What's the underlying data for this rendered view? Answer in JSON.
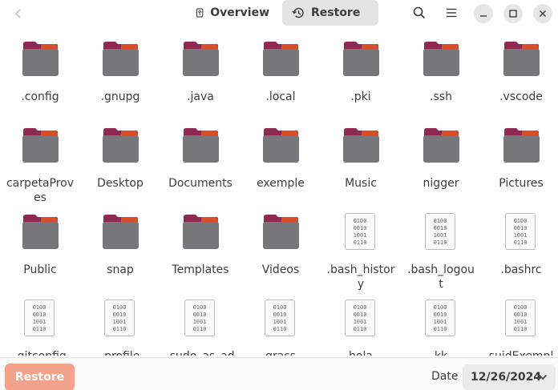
{
  "header": {
    "tabs": [
      {
        "label": "Overview",
        "icon": "device-icon"
      },
      {
        "label": "Restore",
        "icon": "history-icon",
        "active": true
      }
    ]
  },
  "files": [
    {
      "name": ".config",
      "type": "folder"
    },
    {
      "name": ".gnupg",
      "type": "folder"
    },
    {
      "name": ".java",
      "type": "folder"
    },
    {
      "name": ".local",
      "type": "folder"
    },
    {
      "name": ".pki",
      "type": "folder"
    },
    {
      "name": ".ssh",
      "type": "folder"
    },
    {
      "name": ".vscode",
      "type": "folder"
    },
    {
      "name": "carpetaProves",
      "type": "folder"
    },
    {
      "name": "Desktop",
      "type": "folder"
    },
    {
      "name": "Documents",
      "type": "folder"
    },
    {
      "name": "exemple",
      "type": "folder"
    },
    {
      "name": "Music",
      "type": "folder"
    },
    {
      "name": "nigger",
      "type": "folder"
    },
    {
      "name": "Pictures",
      "type": "folder"
    },
    {
      "name": "Public",
      "type": "folder"
    },
    {
      "name": "snap",
      "type": "folder"
    },
    {
      "name": "Templates",
      "type": "folder"
    },
    {
      "name": "Videos",
      "type": "folder"
    },
    {
      "name": ".bash_history",
      "type": "file"
    },
    {
      "name": ".bash_logout",
      "type": "file"
    },
    {
      "name": ".bashrc",
      "type": "file"
    },
    {
      "name": ".gitconfig",
      "type": "file"
    },
    {
      "name": ".profile",
      "type": "file"
    },
    {
      "name": ".sudo_as_admin_successful",
      "type": "file"
    },
    {
      "name": "grass",
      "type": "file"
    },
    {
      "name": "hola",
      "type": "file"
    },
    {
      "name": "kk",
      "type": "file"
    },
    {
      "name": "suidExemple",
      "type": "file"
    }
  ],
  "binary_icon_lines": [
    "0100",
    "0010",
    "1001",
    "0110"
  ],
  "footer": {
    "restore_label": "Restore",
    "date_label": "Date",
    "date_value": "12/26/2024"
  },
  "colors": {
    "folder_body": "#77767b",
    "folder_back": "#8e2a52",
    "folder_tab": "#e95420",
    "restore_button": "#f3a28b",
    "active_tab_bg": "#e4e4e4"
  }
}
